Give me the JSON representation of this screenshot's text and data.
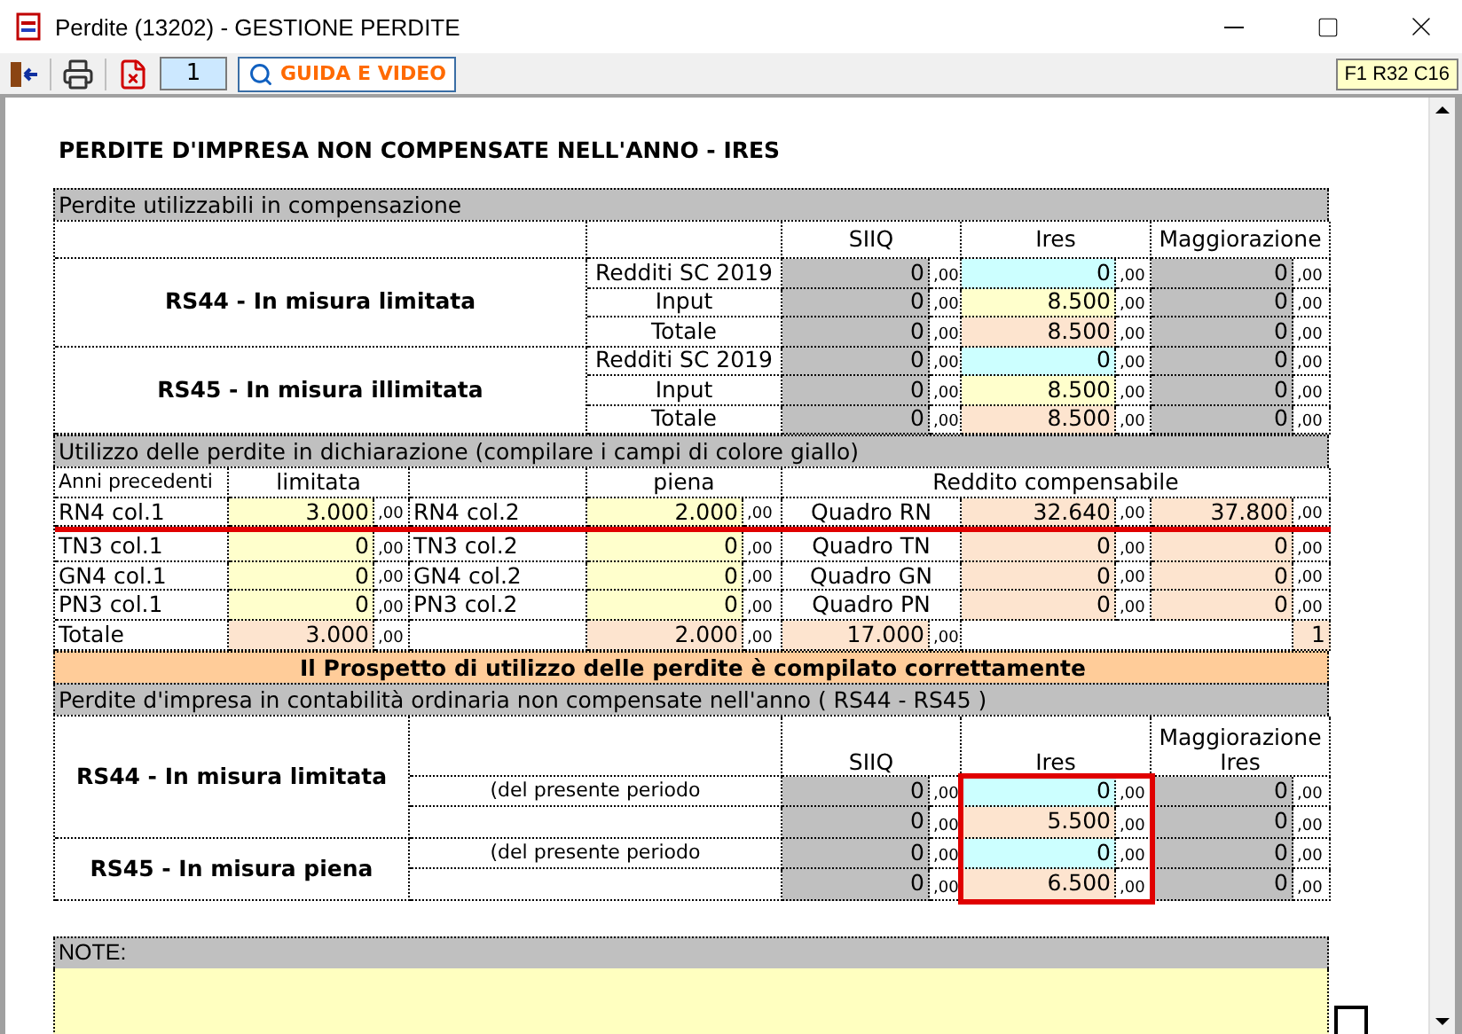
{
  "window": {
    "title": "Perdite (13202) - GESTIONE PERDITE"
  },
  "toolbar": {
    "page": "1",
    "guide_button": "GUIDA E VIDEO",
    "cell_ref": "F1 R32 C16"
  },
  "heading": "PERDITE D'IMPRESA NON COMPENSATE NELL'ANNO - IRES",
  "section1": {
    "title": "Perdite utilizzabili in compensazione",
    "columns": [
      "SIIQ",
      "Ires",
      "Maggiorazione"
    ],
    "groups": [
      {
        "label": "RS44 - In misura limitata",
        "rows": [
          {
            "label": "Redditi SC 2019",
            "cells": [
              {
                "value": "0",
                "cents": ",00",
                "kind": "calc"
              },
              {
                "value": "0",
                "cents": ",00",
                "kind": "auto"
              },
              {
                "value": "0",
                "cents": ",00",
                "kind": "calc"
              }
            ]
          },
          {
            "label": "Input",
            "cells": [
              {
                "value": "0",
                "cents": ",00",
                "kind": "calc"
              },
              {
                "value": "8.500",
                "cents": ",00",
                "kind": "input"
              },
              {
                "value": "0",
                "cents": ",00",
                "kind": "calc"
              }
            ]
          },
          {
            "label": "Totale",
            "cells": [
              {
                "value": "0",
                "cents": ",00",
                "kind": "calc"
              },
              {
                "value": "8.500",
                "cents": ",00",
                "kind": "total"
              },
              {
                "value": "0",
                "cents": ",00",
                "kind": "calc"
              }
            ]
          }
        ]
      },
      {
        "label": "RS45 - In misura illimitata",
        "rows": [
          {
            "label": "Redditi SC 2019",
            "cells": [
              {
                "value": "0",
                "cents": ",00",
                "kind": "calc"
              },
              {
                "value": "0",
                "cents": ",00",
                "kind": "auto"
              },
              {
                "value": "0",
                "cents": ",00",
                "kind": "calc"
              }
            ]
          },
          {
            "label": "Input",
            "cells": [
              {
                "value": "0",
                "cents": ",00",
                "kind": "calc"
              },
              {
                "value": "8.500",
                "cents": ",00",
                "kind": "input"
              },
              {
                "value": "0",
                "cents": ",00",
                "kind": "calc"
              }
            ]
          },
          {
            "label": "Totale",
            "cells": [
              {
                "value": "0",
                "cents": ",00",
                "kind": "calc"
              },
              {
                "value": "8.500",
                "cents": ",00",
                "kind": "total"
              },
              {
                "value": "0",
                "cents": ",00",
                "kind": "calc"
              }
            ]
          }
        ]
      }
    ]
  },
  "section2": {
    "title": "Utilizzo delle perdite in dichiarazione (compilare i campi di colore giallo)",
    "headers": [
      "Anni precedenti",
      "limitata",
      "piena",
      "Reddito compensabile"
    ],
    "rows": [
      {
        "label_limitata": "RN4 col.1",
        "limitata": {
          "value": "3.000",
          "cents": ",00",
          "kind": "input"
        },
        "label_piena": "RN4 col.2",
        "piena": {
          "value": "2.000",
          "cents": ",00",
          "kind": "input"
        },
        "quadro": "Quadro RN",
        "income": [
          {
            "value": "32.640",
            "cents": ",00",
            "kind": "total"
          },
          {
            "value": "37.800",
            "cents": ",00",
            "kind": "total"
          }
        ],
        "highlighted": true
      },
      {
        "label_limitata": "TN3 col.1",
        "limitata": {
          "value": "0",
          "cents": ",00",
          "kind": "input"
        },
        "label_piena": "TN3 col.2",
        "piena": {
          "value": "0",
          "cents": ",00",
          "kind": "input"
        },
        "quadro": "Quadro TN",
        "income": [
          {
            "value": "0",
            "cents": ",00",
            "kind": "total"
          },
          {
            "value": "0",
            "cents": ",00",
            "kind": "total"
          }
        ],
        "highlighted": false
      },
      {
        "label_limitata": "GN4 col.1",
        "limitata": {
          "value": "0",
          "cents": ",00",
          "kind": "input"
        },
        "label_piena": "GN4 col.2",
        "piena": {
          "value": "0",
          "cents": ",00",
          "kind": "input"
        },
        "quadro": "Quadro GN",
        "income": [
          {
            "value": "0",
            "cents": ",00",
            "kind": "total"
          },
          {
            "value": "0",
            "cents": ",00",
            "kind": "total"
          }
        ],
        "highlighted": false
      },
      {
        "label_limitata": "PN3 col.1",
        "limitata": {
          "value": "0",
          "cents": ",00",
          "kind": "input"
        },
        "label_piena": "PN3 col.2",
        "piena": {
          "value": "0",
          "cents": ",00",
          "kind": "input"
        },
        "quadro": "Quadro PN",
        "income": [
          {
            "value": "0",
            "cents": ",00",
            "kind": "total"
          },
          {
            "value": "0",
            "cents": ",00",
            "kind": "total"
          }
        ],
        "highlighted": false
      }
    ],
    "total": {
      "label": "Totale",
      "limitata": {
        "value": "3.000",
        "cents": ",00",
        "kind": "total"
      },
      "piena": {
        "value": "2.000",
        "cents": ",00",
        "kind": "total"
      },
      "sum": {
        "value": "17.000",
        "cents": ",00",
        "kind": "total"
      },
      "count": {
        "value": "1",
        "kind": "total"
      }
    }
  },
  "banner": "Il Prospetto di utilizzo delle perdite è compilato correttamente",
  "section3": {
    "title": "Perdite d'impresa in contabilità ordinaria non compensate nell'anno ( RS44 - RS45 )",
    "columns": [
      "SIIQ",
      "Ires",
      "Maggiorazione Ires"
    ],
    "ires_highlighted": true,
    "groups": [
      {
        "label": "RS44 - In misura limitata",
        "rows": [
          {
            "note": "(del presente periodo",
            "cells": [
              {
                "value": "0",
                "cents": ",00",
                "kind": "calc"
              },
              {
                "value": "0",
                "cents": ",00",
                "kind": "auto"
              },
              {
                "value": "0",
                "cents": ",00",
                "kind": "calc"
              }
            ]
          },
          {
            "cells": [
              {
                "value": "0",
                "cents": ",00",
                "kind": "calc"
              },
              {
                "value": "5.500",
                "cents": ",00",
                "kind": "total"
              },
              {
                "value": "0",
                "cents": ",00",
                "kind": "calc"
              }
            ]
          }
        ]
      },
      {
        "label": "RS45 - In misura piena",
        "rows": [
          {
            "note": "(del presente periodo",
            "cells": [
              {
                "value": "0",
                "cents": ",00",
                "kind": "calc"
              },
              {
                "value": "0",
                "cents": ",00",
                "kind": "auto"
              },
              {
                "value": "0",
                "cents": ",00",
                "kind": "calc"
              }
            ]
          },
          {
            "cells": [
              {
                "value": "0",
                "cents": ",00",
                "kind": "calc"
              },
              {
                "value": "6.500",
                "cents": ",00",
                "kind": "total"
              },
              {
                "value": "0",
                "cents": ",00",
                "kind": "calc"
              }
            ]
          }
        ]
      }
    ]
  },
  "notes": {
    "title": "NOTE:"
  }
}
